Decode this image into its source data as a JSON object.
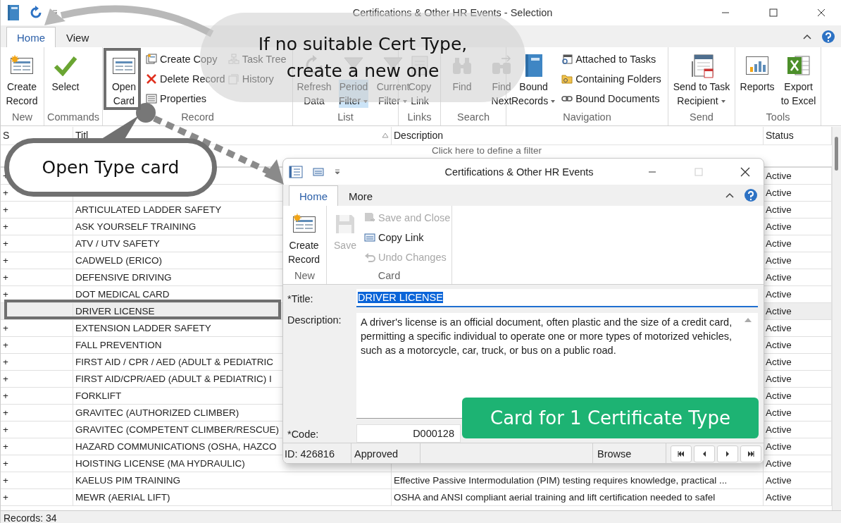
{
  "window": {
    "title": "Certifications & Other HR Events - Selection"
  },
  "tabs": [
    {
      "label": "Home",
      "selected": true
    },
    {
      "label": "View",
      "selected": false
    }
  ],
  "ribbon": {
    "groups": [
      {
        "label": "New",
        "items": [
          {
            "kind": "large",
            "label": "Create\nRecord",
            "dropdown": false,
            "pressed": false
          }
        ]
      },
      {
        "label": "Commands",
        "items": [
          {
            "kind": "large",
            "label": "Select",
            "dropdown": false,
            "pressed": false
          }
        ]
      },
      {
        "label": "Record",
        "items": [
          {
            "kind": "large",
            "label": "Open\nCard",
            "dropdown": false,
            "pressed": false
          },
          {
            "kind": "small",
            "label": "Create Copy"
          },
          {
            "kind": "small",
            "label": "Delete Record"
          },
          {
            "kind": "small",
            "label": "Properties"
          },
          {
            "kind": "small",
            "label": "Task Tree"
          },
          {
            "kind": "small",
            "label": "History"
          }
        ]
      },
      {
        "label": "List",
        "items": [
          {
            "kind": "large",
            "label": "Refresh\nData",
            "dropdown": false,
            "pressed": false
          },
          {
            "kind": "large",
            "label": "Period\nFilter",
            "dropdown": true,
            "pressed": true
          },
          {
            "kind": "large",
            "label": "Current\nFilter",
            "dropdown": true,
            "pressed": false
          }
        ]
      },
      {
        "label": "Links",
        "items": [
          {
            "kind": "large",
            "label": "Copy\nLink",
            "dropdown": false,
            "pressed": false
          }
        ]
      },
      {
        "label": "Search",
        "items": [
          {
            "kind": "large",
            "label": "Find",
            "dropdown": false,
            "pressed": false
          },
          {
            "kind": "large",
            "label": "Find\nNext",
            "dropdown": false,
            "pressed": false
          }
        ]
      },
      {
        "label": "Navigation",
        "items": [
          {
            "kind": "large",
            "label": "Bound\nRecords",
            "dropdown": true,
            "pressed": false
          },
          {
            "kind": "small",
            "label": "Attached to Tasks"
          },
          {
            "kind": "small",
            "label": "Containing Folders"
          },
          {
            "kind": "small",
            "label": "Bound Documents"
          }
        ]
      },
      {
        "label": "Send",
        "items": [
          {
            "kind": "large",
            "label": "Send to Task\nRecipient",
            "dropdown": true,
            "pressed": false
          }
        ]
      },
      {
        "label": "Tools",
        "items": [
          {
            "kind": "large",
            "label": "Reports",
            "dropdown": false,
            "pressed": false
          },
          {
            "kind": "large",
            "label": "Export\nto Excel",
            "dropdown": false,
            "pressed": false
          }
        ]
      }
    ]
  },
  "table": {
    "columns": [
      "S",
      "Titl",
      "Description",
      "Status"
    ],
    "filter_hint": "Click here to define a filter",
    "rows": [
      {
        "sign": "+",
        "status": "Active",
        "selected": false
      },
      {
        "sign": "+",
        "status": "Active",
        "selected": false
      },
      {
        "sign": "+",
        "title": "ARTICULATED LADDER SAFETY",
        "status": "Active",
        "selected": false
      },
      {
        "sign": "+",
        "title": "ASK YOURSELF TRAINING",
        "status": "Active",
        "selected": false
      },
      {
        "sign": "+",
        "title": "ATV / UTV SAFETY",
        "status": "Active",
        "selected": false
      },
      {
        "sign": "+",
        "title": "CADWELD (ERICO)",
        "status": "Active",
        "selected": false
      },
      {
        "sign": "+",
        "title": "DEFENSIVE DRIVING",
        "status": "Active",
        "selected": false
      },
      {
        "sign": "+",
        "title": "DOT MEDICAL CARD",
        "status": "Active",
        "selected": false
      },
      {
        "title": "DRIVER LICENSE",
        "status": "Active",
        "selected": true
      },
      {
        "sign": "+",
        "title": "EXTENSION LADDER SAFETY",
        "status": "Active",
        "selected": false
      },
      {
        "sign": "+",
        "title": "FALL PREVENTION",
        "status": "Active",
        "selected": false
      },
      {
        "sign": "+",
        "title": "FIRST AID / CPR / AED (ADULT & PEDIATRIC",
        "status": "Active",
        "selected": false
      },
      {
        "sign": "+",
        "title": "FIRST AID/CPR/AED (ADULT & PEDIATRIC) I",
        "status": "Active",
        "selected": false
      },
      {
        "sign": "+",
        "title": "FORKLIFT",
        "status": "Active",
        "selected": false
      },
      {
        "sign": "+",
        "title": "GRAVITEC (AUTHORIZED CLIMBER)",
        "status": "Active",
        "selected": false
      },
      {
        "sign": "+",
        "title": "GRAVITEC (COMPETENT CLIMBER/RESCUE)",
        "status": "Active",
        "selected": false
      },
      {
        "sign": "+",
        "title": "HAZARD COMMUNICATIONS (OSHA, HAZCO",
        "status": "Active",
        "selected": false
      },
      {
        "sign": "+",
        "title": "HOISTING LICENSE (MA HYDRAULIC)",
        "status": "Active",
        "selected": false
      },
      {
        "sign": "+",
        "title": "KAELUS PIM TRAINING",
        "description": "Effective Passive Intermodulation (PIM) testing requires knowledge, practical ...",
        "status": "Active",
        "selected": false
      },
      {
        "sign": "+",
        "title": "MEWR (AERIAL LIFT)",
        "description": "OSHA and ANSI compliant aerial training and lift certification needed to safel",
        "status": "Active",
        "selected": false
      }
    ]
  },
  "status_bar": "Records: 34",
  "dialog": {
    "title": "Certifications & Other HR Events",
    "tabs": [
      {
        "label": "Home",
        "selected": true
      },
      {
        "label": "More",
        "selected": false
      }
    ],
    "groups": [
      {
        "label": "New",
        "items": [
          {
            "kind": "large",
            "label": "Create\nRecord",
            "disabled": false
          }
        ]
      },
      {
        "label": "Card",
        "items": [
          {
            "kind": "large",
            "label": "Save",
            "disabled": true
          },
          {
            "kind": "small",
            "label": "Save and Close",
            "disabled": true
          },
          {
            "kind": "small",
            "label": "Copy Link",
            "disabled": false
          },
          {
            "kind": "small",
            "label": "Undo Changes",
            "disabled": true
          }
        ]
      }
    ],
    "fields": {
      "title_label": "*Title:",
      "title_value": "DRIVER LICENSE",
      "description_label": "Description:",
      "description_value": "A driver's license is an official document, often plastic and the size of a credit card, permitting a specific individual to operate one or more types of motorized vehicles, such as a motorcycle, car, truck, or bus on a public road.",
      "code_label": "*Code:",
      "code_value": "D000128"
    },
    "status": {
      "id": "ID: 426816",
      "state": "Approved",
      "mode": "Browse"
    }
  },
  "callouts": [
    {
      "kind": "bubble",
      "text": "If no suitable Cert Type,\ncreate a new one"
    },
    {
      "kind": "pill",
      "text": "Open Type card"
    },
    {
      "kind": "tag",
      "text": "Card for 1 Certificate Type"
    }
  ]
}
